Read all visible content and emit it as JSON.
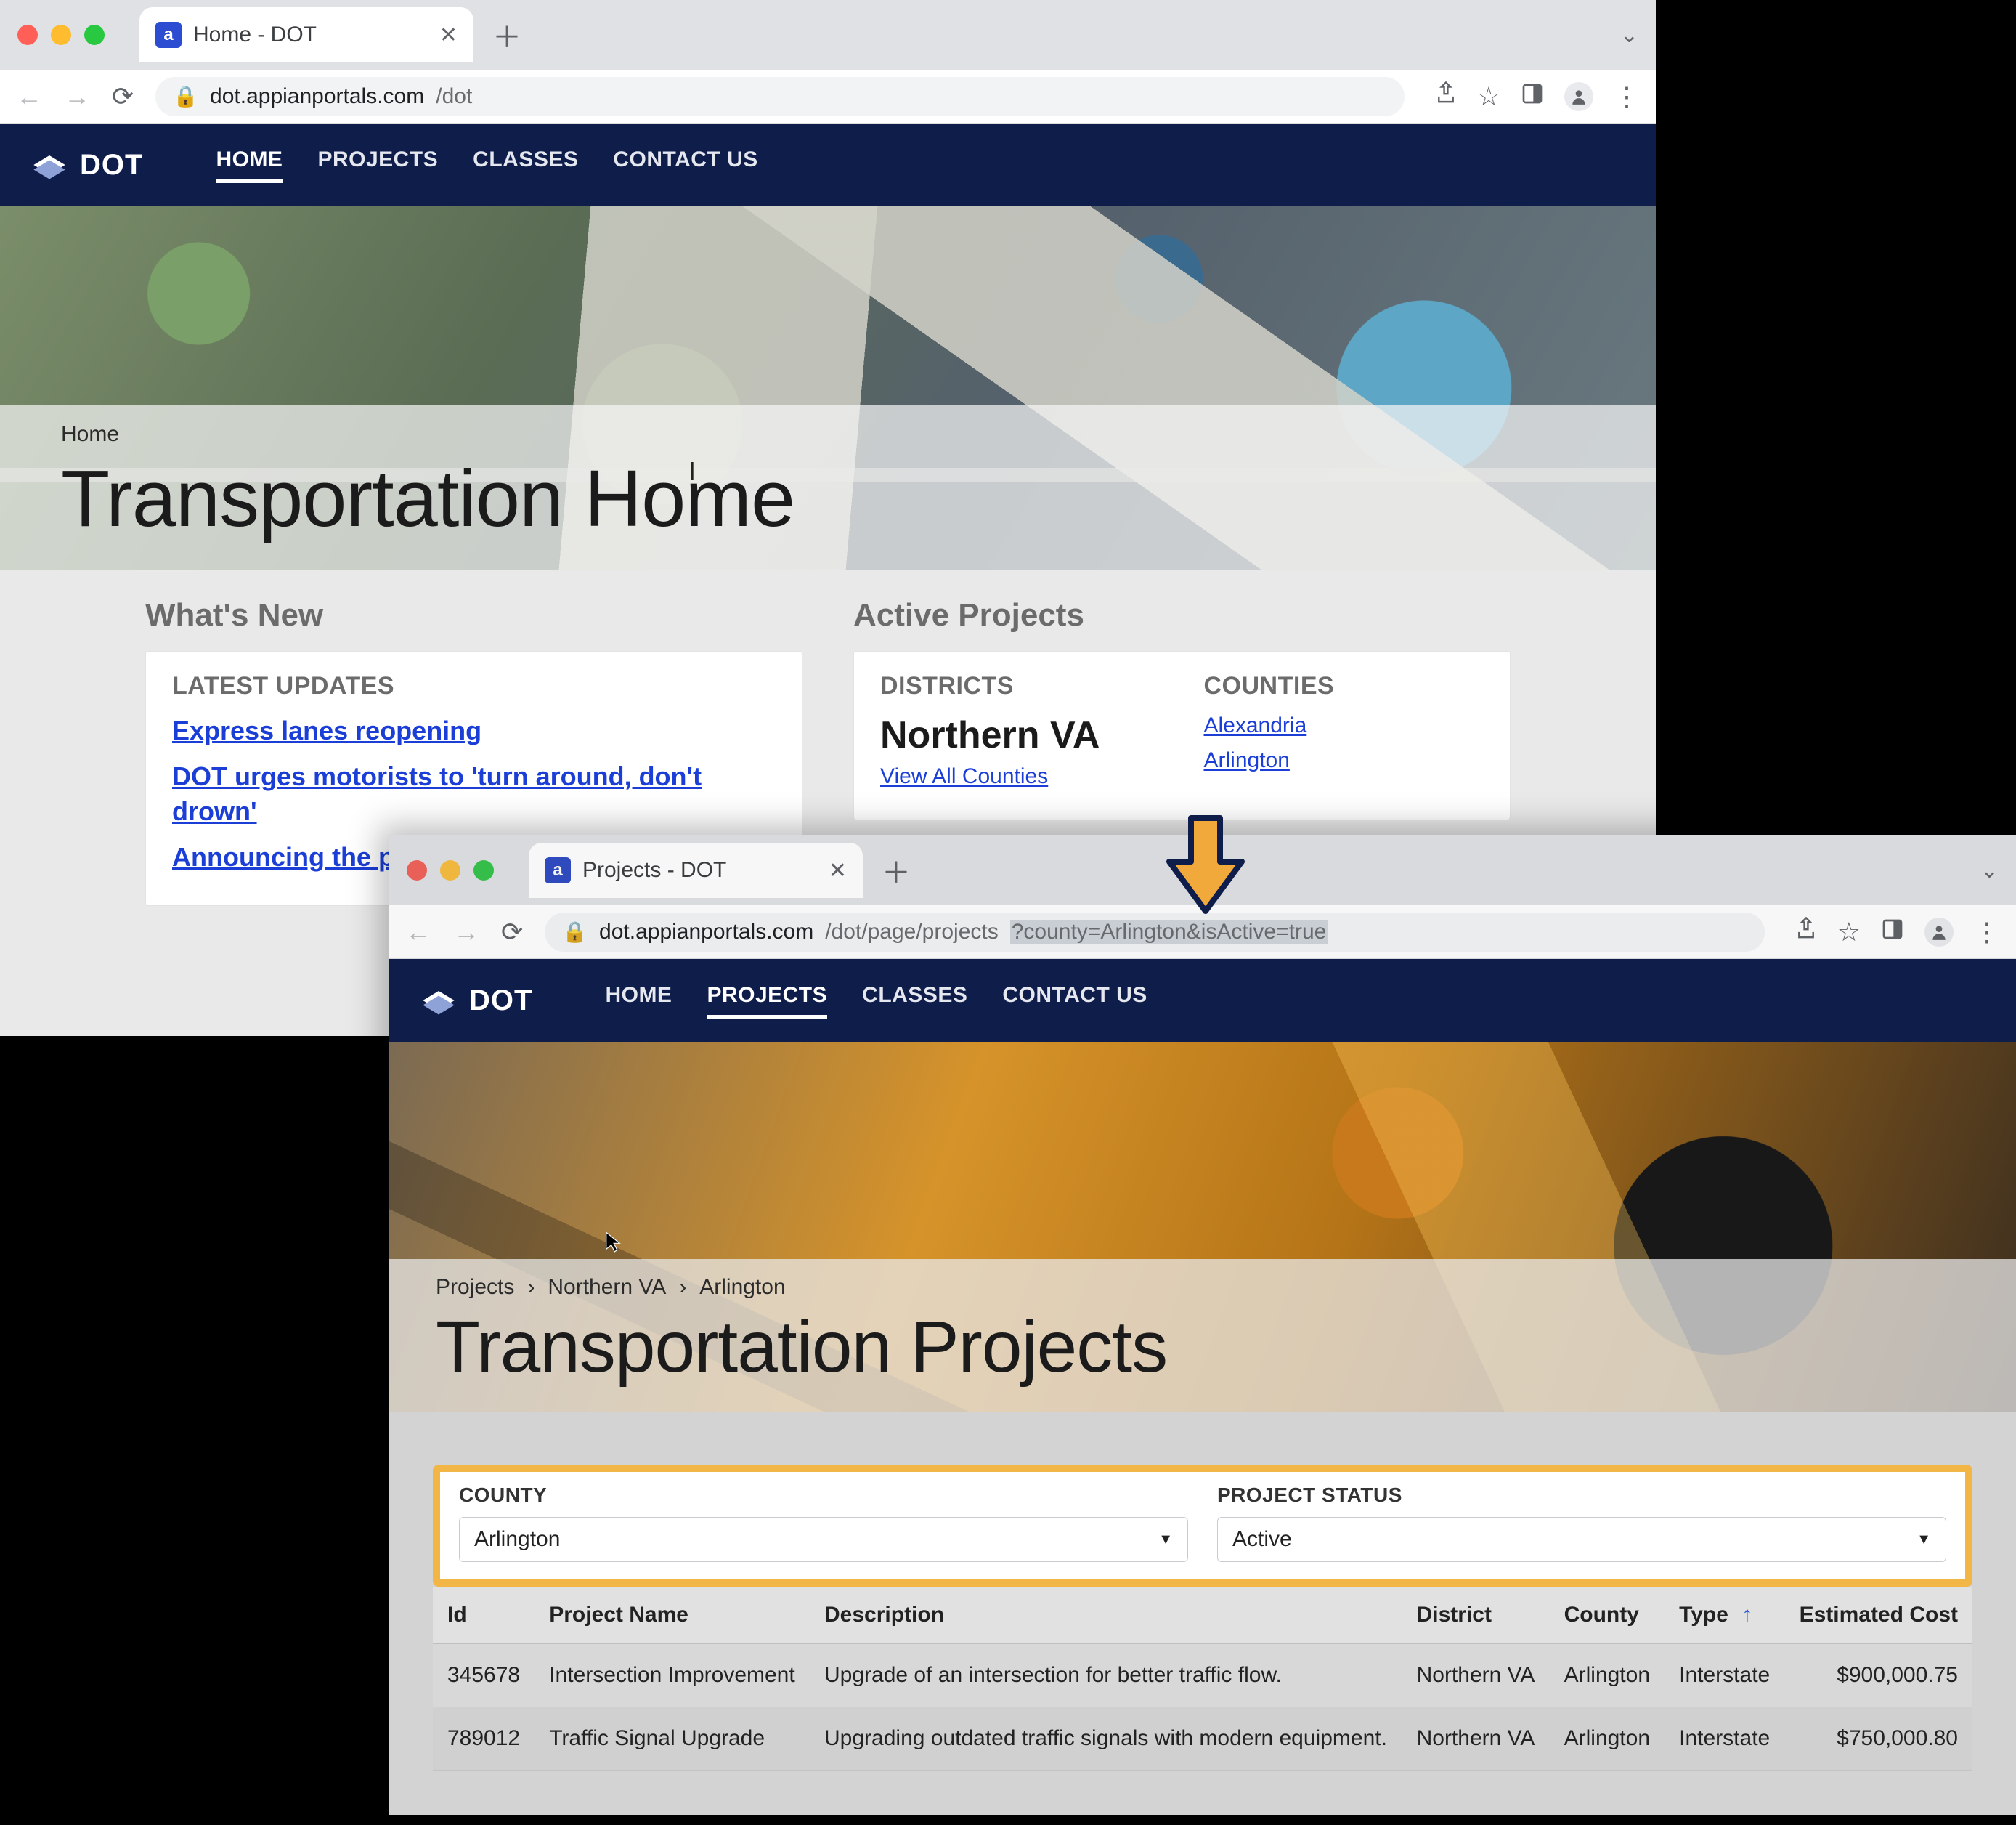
{
  "window1": {
    "tab_title": "Home - DOT",
    "url_host": "dot.appianportals.com",
    "url_path": "/dot",
    "brand": "DOT",
    "nav": {
      "home": "HOME",
      "projects": "PROJECTS",
      "classes": "CLASSES",
      "contact": "CONTACT US"
    },
    "breadcrumb": "Home",
    "page_title": "Transportation Home",
    "whats_new_hd": "What's New",
    "latest_hd": "LATEST UPDATES",
    "updates": [
      "Express lanes reopening",
      "DOT urges motorists to 'turn around, don't drown'",
      "Announcing the                         project"
    ],
    "active_hd": "Active Projects",
    "districts_hd": "DISTRICTS",
    "district_name": "Northern VA",
    "view_all": "View All Counties",
    "counties_hd": "COUNTIES",
    "counties": [
      "Alexandria",
      "Arlington"
    ]
  },
  "window2": {
    "tab_title": "Projects - DOT",
    "url_host": "dot.appianportals.com",
    "url_path_plain": "/dot/page/projects",
    "url_query": "?county=Arlington&isActive=true",
    "brand": "DOT",
    "nav": {
      "home": "HOME",
      "projects": "PROJECTS",
      "classes": "CLASSES",
      "contact": "CONTACT US"
    },
    "breadcrumb": {
      "a": "Projects",
      "b": "Northern VA",
      "c": "Arlington"
    },
    "page_title": "Transportation Projects",
    "filters": {
      "county_label": "COUNTY",
      "county_value": "Arlington",
      "status_label": "PROJECT STATUS",
      "status_value": "Active"
    },
    "columns": {
      "id": "Id",
      "name": "Project Name",
      "desc": "Description",
      "district": "District",
      "county": "County",
      "type": "Type",
      "cost": "Estimated Cost"
    },
    "rows": [
      {
        "id": "345678",
        "name": "Intersection Improvement",
        "desc": "Upgrade of an intersection for better traffic flow.",
        "district": "Northern VA",
        "county": "Arlington",
        "type": "Interstate",
        "cost": "$900,000.75"
      },
      {
        "id": "789012",
        "name": "Traffic Signal Upgrade",
        "desc": "Upgrading outdated traffic signals with modern equipment.",
        "district": "Northern VA",
        "county": "Arlington",
        "type": "Interstate",
        "cost": "$750,000.80"
      }
    ]
  }
}
